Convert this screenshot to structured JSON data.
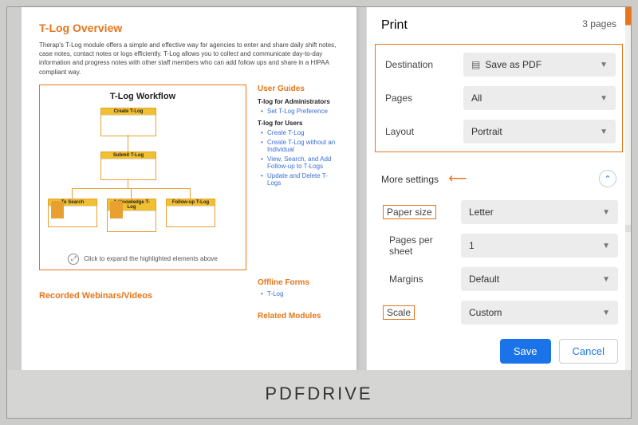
{
  "footer": "PDFDRIVE",
  "doc": {
    "title": "T-Log Overview",
    "intro": "Therap's T-Log module offers a simple and effective way for agencies to enter and share daily shift notes, case notes, contact notes or logs efficiently. T-Log allows you to collect and communicate day-to-day information and progress notes with other staff members who can add follow ups and share in a HIPAA compliant way.",
    "workflow_title": "T-Log Workflow",
    "nodes": {
      "n1": "Create T-Log",
      "n2": "Submit T-Log",
      "n3": "To Search",
      "n4": "Acknowledge T-Log",
      "n5": "Follow-up T-Log"
    },
    "expand_note": "Click to expand the highlighted elements above",
    "user_guides": "User Guides",
    "admin_h": "T-log for Administrators",
    "admin_links": [
      "Set T-Log Preference"
    ],
    "users_h": "T-log for Users",
    "users_links": [
      "Create T-Log",
      "Create T-Log without an Individual",
      "View, Search, and Add Follow-up to T-Logs",
      "Update and Delete T-Logs"
    ],
    "recorded": "Recorded Webinars/Videos",
    "offline_h": "Offline Forms",
    "offline_links": [
      "T-Log"
    ],
    "related_h": "Related Modules"
  },
  "print": {
    "title": "Print",
    "count": "3 pages",
    "dest_label": "Destination",
    "dest_value": "Save as PDF",
    "pages_label": "Pages",
    "pages_value": "All",
    "layout_label": "Layout",
    "layout_value": "Portrait",
    "more": "More settings",
    "paper_label": "Paper size",
    "paper_value": "Letter",
    "pps_label": "Pages per sheet",
    "pps_value": "1",
    "margins_label": "Margins",
    "margins_value": "Default",
    "scale_label": "Scale",
    "scale_value": "Custom",
    "save": "Save",
    "cancel": "Cancel"
  }
}
